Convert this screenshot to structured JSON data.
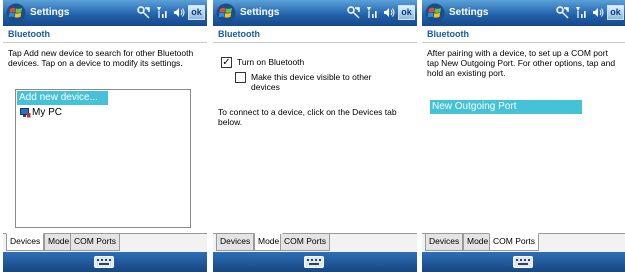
{
  "screens": [
    {
      "title": "Settings",
      "ok": "ok",
      "header": "Bluetooth",
      "description": "Tap Add new device to search for other Bluetooth devices. Tap on a device to modify its settings.",
      "items": [
        "Add new device...",
        "My PC"
      ],
      "tabs": [
        "Devices",
        "Mode",
        "COM Ports"
      ],
      "active_tab": "Devices"
    },
    {
      "title": "Settings",
      "ok": "ok",
      "header": "Bluetooth",
      "turn_on_label": "Turn on Bluetooth",
      "turn_on_checked": true,
      "visible_label": "Make this device visible to other devices",
      "visible_checked": false,
      "note": "To connect to a device, click on the Devices tab below.",
      "tabs": [
        "Devices",
        "Mode",
        "COM Ports"
      ],
      "active_tab": "Mode"
    },
    {
      "title": "Settings",
      "ok": "ok",
      "header": "Bluetooth",
      "description": "After pairing with a device, to set up a COM port tap New Outgoing Port. For other options, tap and hold an existing port.",
      "items": [
        "New Outgoing Port"
      ],
      "tabs": [
        "Devices",
        "Mode",
        "COM Ports"
      ],
      "active_tab": "COM Ports"
    }
  ],
  "colors": {
    "titlebar": "#1f5fa8",
    "header_text": "#1a5aa8",
    "selection": "#45c2d8"
  },
  "icons": [
    "windows-start-icon",
    "connectivity-icon",
    "signal-icon",
    "volume-icon",
    "device-pc-icon",
    "keyboard-icon"
  ]
}
